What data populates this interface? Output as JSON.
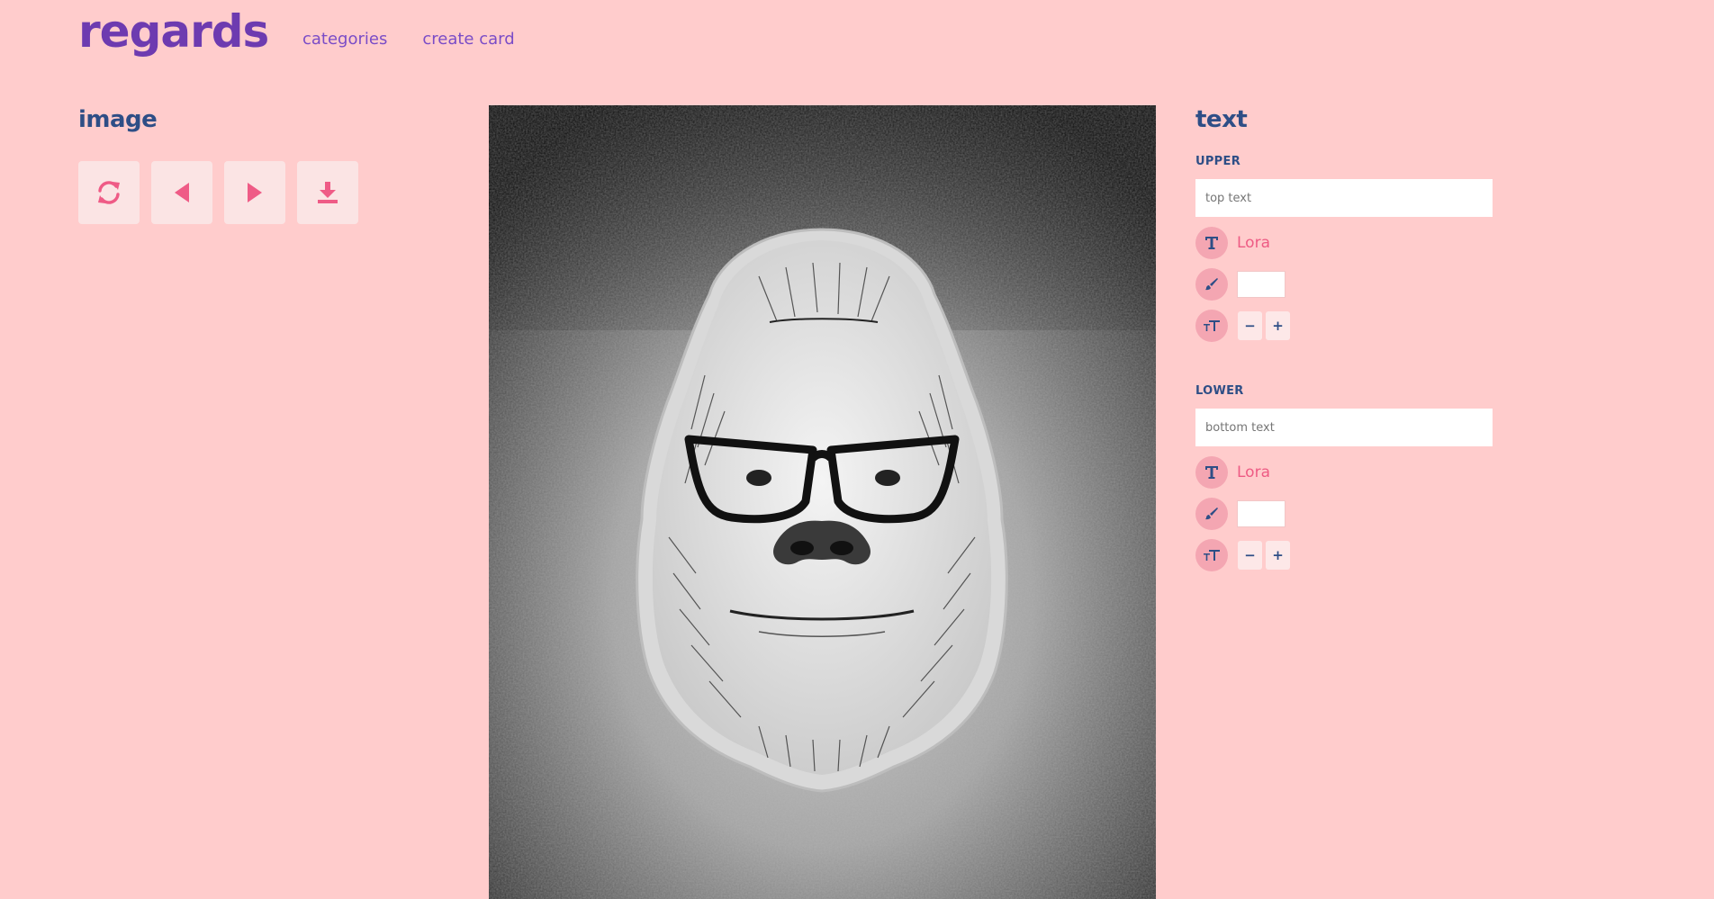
{
  "header": {
    "logo": "regards",
    "nav": [
      "categories",
      "create card"
    ]
  },
  "image_panel": {
    "title": "image",
    "controls": [
      {
        "icon": "refresh-icon"
      },
      {
        "icon": "previous-icon"
      },
      {
        "icon": "next-icon"
      },
      {
        "icon": "download-icon"
      }
    ]
  },
  "preview": {
    "subject": "gorilla-with-glasses-illustration"
  },
  "text_panel": {
    "title": "text",
    "upper": {
      "label": "UPPER",
      "placeholder": "top text",
      "font": "Lora",
      "color": "#ffffff",
      "size_minus": "−",
      "size_plus": "+"
    },
    "lower": {
      "label": "LOWER",
      "placeholder": "bottom text",
      "font": "Lora",
      "color": "#ffffff",
      "size_minus": "−",
      "size_plus": "+"
    }
  },
  "colors": {
    "background": "#ffcccc",
    "logo": "#6d3bb0",
    "heading": "#2e4e86",
    "accent": "#ee5b84"
  }
}
